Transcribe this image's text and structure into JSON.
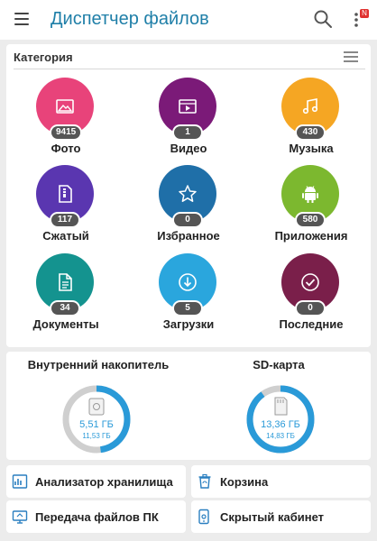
{
  "app": {
    "title": "Диспетчер файлов",
    "notification_badge": "N",
    "accent": "#1f7fa8"
  },
  "categories": {
    "header": "Категория",
    "items": [
      {
        "label": "Фото",
        "count": "9415",
        "color": "#e8437a",
        "icon": "image-icon"
      },
      {
        "label": "Видео",
        "count": "1",
        "color": "#7b1a78",
        "icon": "video-icon"
      },
      {
        "label": "Музыка",
        "count": "430",
        "color": "#f5a623",
        "icon": "music-note-icon"
      },
      {
        "label": "Сжатый",
        "count": "117",
        "color": "#5a36b0",
        "icon": "archive-icon"
      },
      {
        "label": "Избранное",
        "count": "0",
        "color": "#1f6fa8",
        "icon": "star-icon"
      },
      {
        "label": "Приложения",
        "count": "580",
        "color": "#7cb82f",
        "icon": "android-icon"
      },
      {
        "label": "Документы",
        "count": "34",
        "color": "#14938f",
        "icon": "document-icon"
      },
      {
        "label": "Загрузки",
        "count": "5",
        "color": "#2aa6dd",
        "icon": "download-icon"
      },
      {
        "label": "Последние",
        "count": "0",
        "color": "#7a1f4a",
        "icon": "recent-check-icon"
      }
    ]
  },
  "storage": {
    "internal": {
      "title": "Внутренний накопитель",
      "used": "5,51 ГБ",
      "total": "11,53 ГБ",
      "fraction": 0.478
    },
    "sd": {
      "title": "SD-карта",
      "used": "13,36 ГБ",
      "total": "14,83 ГБ",
      "fraction": 0.901
    },
    "used_color": "#2a9ad8",
    "free_color": "#cfcfcf"
  },
  "tools": {
    "analyzer": "Анализатор хранилища",
    "trash": "Корзина",
    "pc_transfer": "Передача файлов ПК",
    "hidden_cabinet": "Скрытый кабинет"
  }
}
